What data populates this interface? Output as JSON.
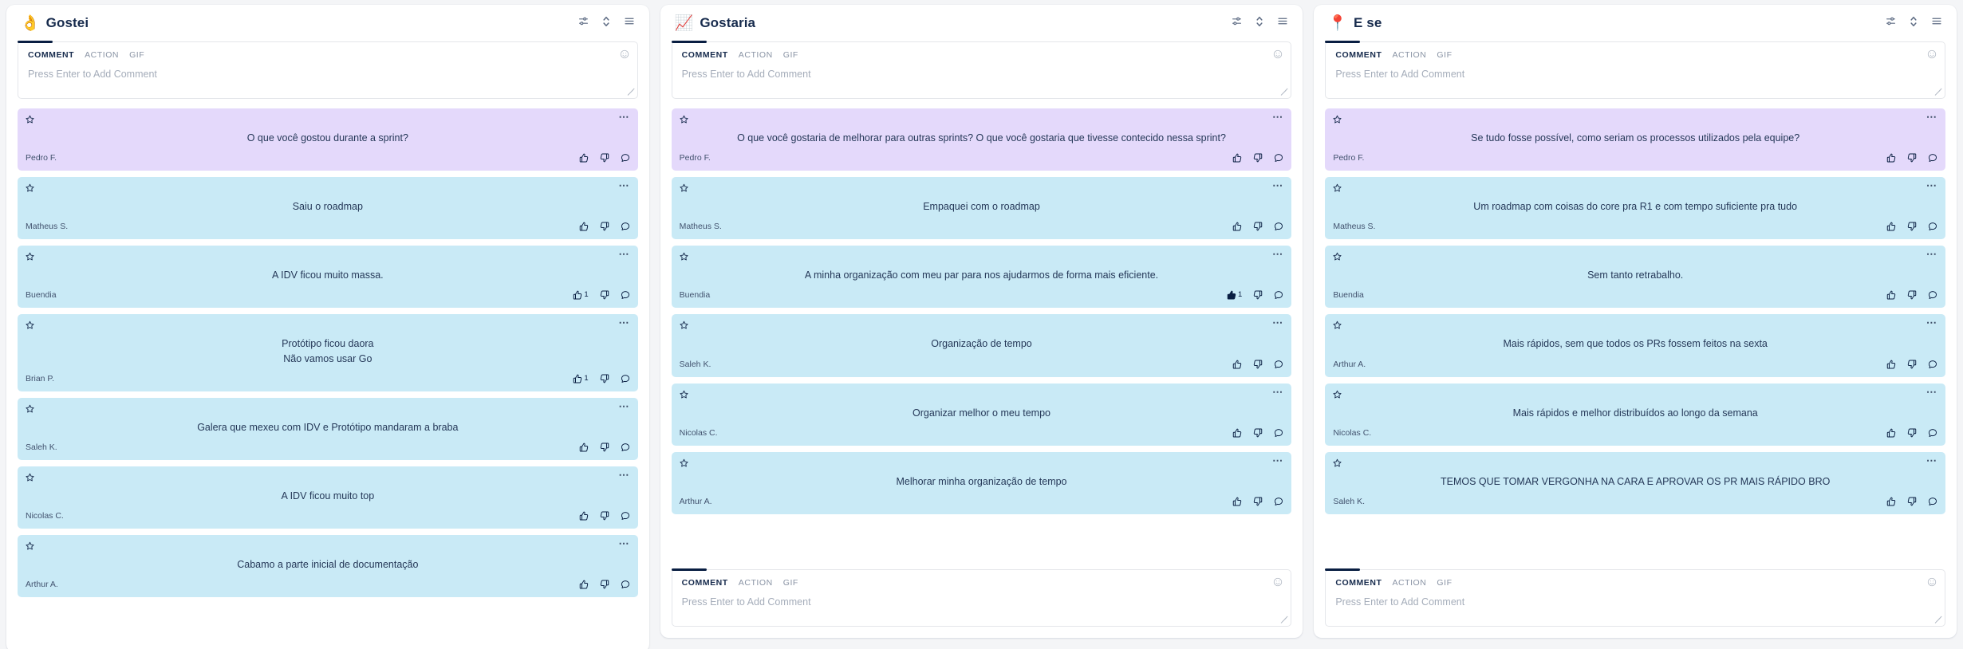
{
  "board": {
    "background": "#f4f5f7",
    "card_colors": {
      "prompt": "#e4d9fb",
      "note": "#c9eaf6"
    },
    "accent": "#091e42"
  },
  "composer": {
    "tabs": {
      "comment": "COMMENT",
      "action": "ACTION",
      "gif": "GIF"
    },
    "placeholder": "Press Enter to Add Comment",
    "emoji_icon": "smiley-icon",
    "resize_icon": "resize-grip-icon"
  },
  "toolbar_icons": {
    "filter": "sliders-filter-icon",
    "sort": "sort-updown-icon",
    "list": "list-menu-icon"
  },
  "columns": [
    {
      "id": "gostei",
      "emoji": "👌",
      "emoji_name": "ok-hand-icon",
      "title": "Gostei",
      "composer_position": "top",
      "height_variant": "tall",
      "cards": [
        {
          "type": "prompt",
          "lines": [
            "O que você gostou durante a sprint?"
          ],
          "author": "Pedro F.",
          "likes": "",
          "dislikes": "",
          "liked": false
        },
        {
          "type": "note",
          "lines": [
            "Saiu o roadmap"
          ],
          "author": "Matheus S.",
          "likes": "",
          "dislikes": "",
          "liked": false
        },
        {
          "type": "note",
          "lines": [
            "A IDV ficou muito massa."
          ],
          "author": "Buendia",
          "likes": "1",
          "dislikes": "",
          "liked": false
        },
        {
          "type": "note",
          "lines": [
            "Protótipo ficou daora",
            "Não vamos usar Go"
          ],
          "author": "Brian P.",
          "likes": "1",
          "dislikes": "",
          "liked": false
        },
        {
          "type": "note",
          "lines": [
            "Galera que mexeu com IDV e Protótipo mandaram a braba"
          ],
          "author": "Saleh K.",
          "likes": "",
          "dislikes": "",
          "liked": false
        },
        {
          "type": "note",
          "lines": [
            "A IDV ficou muito top"
          ],
          "author": "Nicolas C.",
          "likes": "",
          "dislikes": "",
          "liked": false
        },
        {
          "type": "note",
          "lines": [
            "Cabamo a parte inicial de documentação"
          ],
          "author": "Arthur A.",
          "likes": "",
          "dislikes": "",
          "liked": false
        }
      ]
    },
    {
      "id": "gostaria",
      "emoji": "📈",
      "emoji_name": "chart-increasing-icon",
      "title": "Gostaria",
      "composer_position": "both",
      "height_variant": "medium",
      "cards": [
        {
          "type": "prompt",
          "lines": [
            "O que você gostaria de melhorar para outras sprints? O que você gostaria que tivesse contecido nessa sprint?"
          ],
          "author": "Pedro F.",
          "likes": "",
          "dislikes": "",
          "liked": false
        },
        {
          "type": "note",
          "lines": [
            "Empaquei com o roadmap"
          ],
          "author": "Matheus S.",
          "likes": "",
          "dislikes": "",
          "liked": false
        },
        {
          "type": "note",
          "lines": [
            "A minha organização com meu par para nos ajudarmos de forma mais eficiente."
          ],
          "author": "Buendia",
          "likes": "1",
          "dislikes": "",
          "liked": true
        },
        {
          "type": "note",
          "lines": [
            "Organização de tempo"
          ],
          "author": "Saleh K.",
          "likes": "",
          "dislikes": "",
          "liked": false
        },
        {
          "type": "note",
          "lines": [
            "Organizar melhor o meu tempo"
          ],
          "author": "Nicolas C.",
          "likes": "",
          "dislikes": "",
          "liked": false
        },
        {
          "type": "note",
          "lines": [
            "Melhorar minha organização de tempo"
          ],
          "author": "Arthur A.",
          "likes": "",
          "dislikes": "",
          "liked": false
        }
      ]
    },
    {
      "id": "e-se",
      "emoji": "📍",
      "emoji_name": "round-pushpin-icon",
      "title": "E se",
      "composer_position": "both",
      "height_variant": "medium",
      "cards": [
        {
          "type": "prompt",
          "lines": [
            "Se tudo fosse possível, como seriam os processos utilizados pela equipe?"
          ],
          "author": "Pedro F.",
          "likes": "",
          "dislikes": "",
          "liked": false
        },
        {
          "type": "note",
          "lines": [
            "Um roadmap com coisas do core pra R1 e com tempo suficiente pra tudo"
          ],
          "author": "Matheus S.",
          "likes": "",
          "dislikes": "",
          "liked": false
        },
        {
          "type": "note",
          "lines": [
            "Sem tanto retrabalho."
          ],
          "author": "Buendia",
          "likes": "",
          "dislikes": "",
          "liked": false
        },
        {
          "type": "note",
          "lines": [
            "Mais rápidos, sem que todos os PRs fossem feitos na sexta"
          ],
          "author": "Arthur A.",
          "likes": "",
          "dislikes": "",
          "liked": false
        },
        {
          "type": "note",
          "lines": [
            "Mais rápidos e melhor distribuídos ao longo da semana"
          ],
          "author": "Nicolas C.",
          "likes": "",
          "dislikes": "",
          "liked": false
        },
        {
          "type": "note",
          "lines": [
            "TEMOS QUE TOMAR VERGONHA NA CARA E APROVAR OS PR MAIS RÁPIDO BRO"
          ],
          "author": "Saleh K.",
          "likes": "",
          "dislikes": "",
          "liked": false
        }
      ]
    }
  ]
}
